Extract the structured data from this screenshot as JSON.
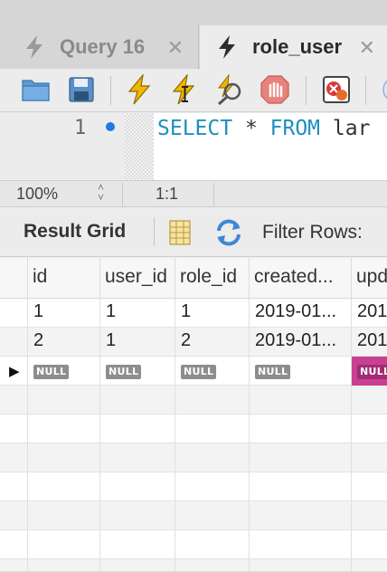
{
  "tabs": [
    {
      "label": "Query 16",
      "active": false,
      "icon": "lightning-icon"
    },
    {
      "label": "role_user",
      "active": true,
      "icon": "lightning-icon"
    }
  ],
  "toolbar": {
    "icons": [
      "open-folder-icon",
      "save-icon",
      "execute-icon",
      "execute-current-icon",
      "explain-icon",
      "stop-icon",
      "toggle-error-icon"
    ]
  },
  "editor": {
    "line_number": "1",
    "keyword1": "SELECT",
    "star": " * ",
    "keyword2": "FROM",
    "rest": " lar"
  },
  "statusbar": {
    "zoom": "100%",
    "cursor": "1:1"
  },
  "result_toolbar": {
    "result_grid_label": "Result Grid",
    "filter_label": "Filter Rows:"
  },
  "grid": {
    "columns": [
      "id",
      "user_id",
      "role_id",
      "created...",
      "upd"
    ],
    "rows": [
      [
        "1",
        "1",
        "1",
        "2019-01...",
        "201"
      ],
      [
        "2",
        "1",
        "2",
        "2019-01...",
        "201"
      ]
    ],
    "new_row": [
      "NULL",
      "NULL",
      "NULL",
      "NULL",
      "NULL"
    ]
  },
  "colors": {
    "keyword": "#1f8fbf",
    "null_highlight": "#c93f93",
    "breakpoint": "#1f7ae0"
  }
}
